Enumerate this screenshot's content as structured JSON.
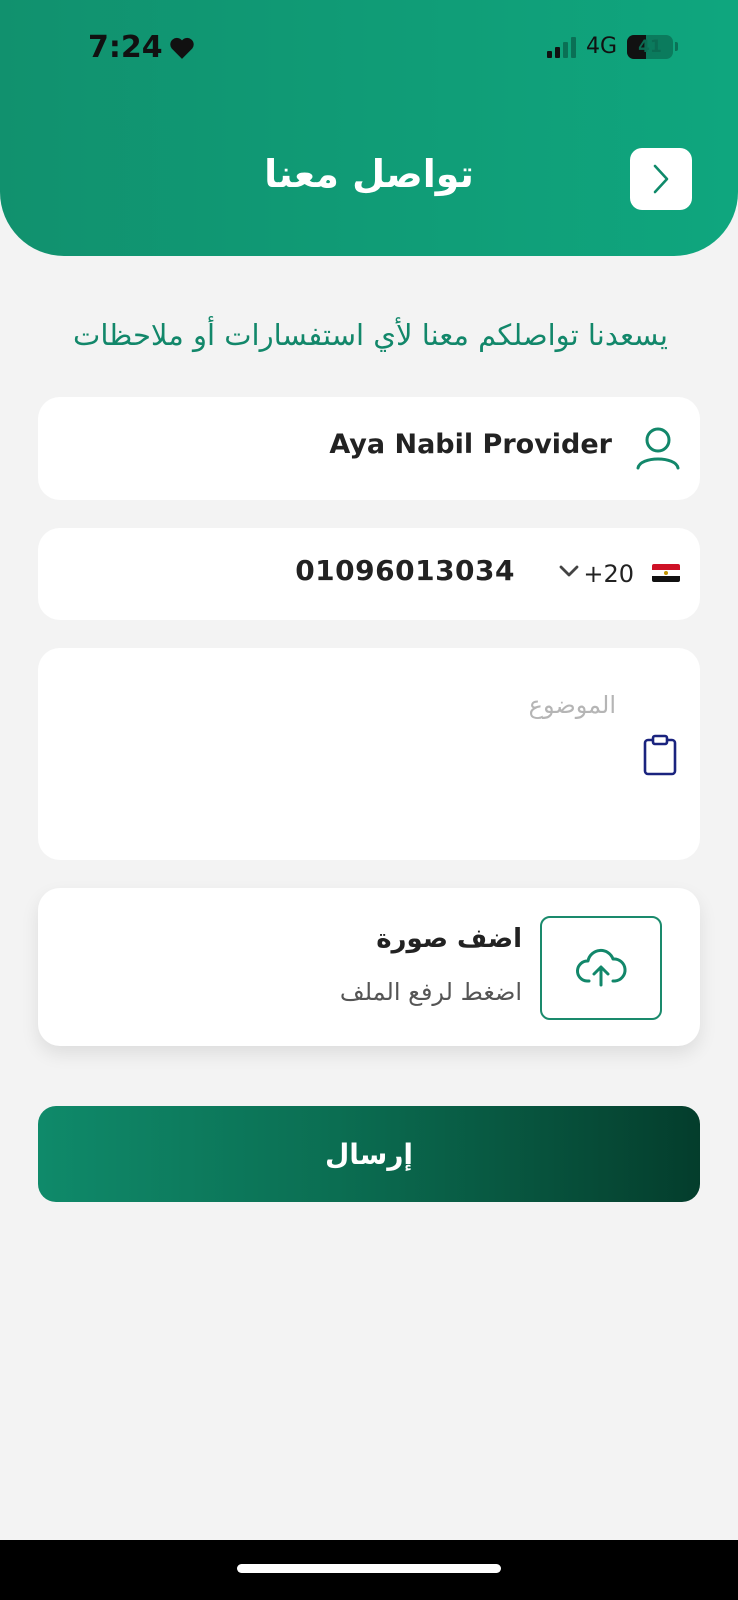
{
  "status_bar": {
    "time": "7:24",
    "network": "4G",
    "battery": "41"
  },
  "header": {
    "title": "تواصل معنا"
  },
  "intro": {
    "text": "يسعدنا تواصلكم معنا لأي استفسارات أو ملاحظات"
  },
  "form": {
    "name_value": "Aya Nabil Provider",
    "phone_number": "01096013034",
    "country_code": "+20",
    "subject_placeholder": "الموضوع",
    "upload_title": "اضف صورة",
    "upload_subtitle": "اضغط لرفع الملف",
    "submit_label": "إرسال"
  },
  "colors": {
    "primary": "#12876a",
    "primary_dark": "#043d2c",
    "background": "#f3f3f3"
  }
}
